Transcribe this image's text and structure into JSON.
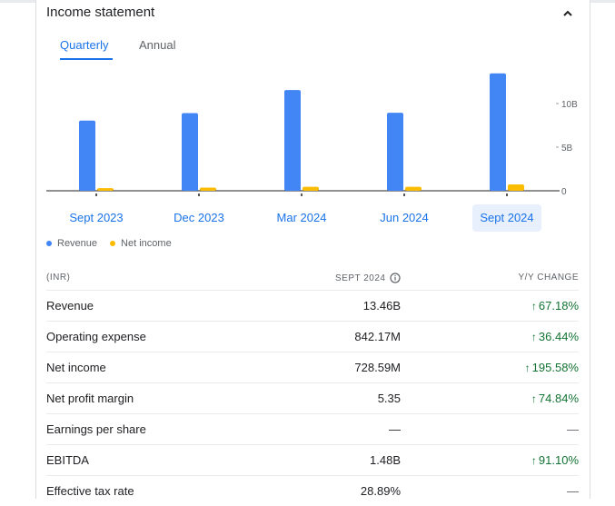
{
  "header": {
    "title": "Income statement"
  },
  "tabs": [
    {
      "label": "Quarterly",
      "active": true
    },
    {
      "label": "Annual",
      "active": false
    }
  ],
  "chart_data": {
    "type": "bar",
    "categories": [
      "Sept 2023",
      "Dec 2023",
      "Mar 2024",
      "Jun 2024",
      "Sept 2024"
    ],
    "series": [
      {
        "name": "Revenue",
        "color": "#4285f4",
        "values": [
          8.05,
          8.9,
          11.55,
          8.95,
          13.46
        ]
      },
      {
        "name": "Net income",
        "color": "#fbbc04",
        "values": [
          0.3,
          0.37,
          0.45,
          0.45,
          0.73
        ]
      }
    ],
    "yticks": [
      {
        "value": 0,
        "label": "0"
      },
      {
        "value": 5,
        "label": "5B"
      },
      {
        "value": 10,
        "label": "10B"
      }
    ],
    "ylim": [
      0,
      15
    ],
    "selected_category": "Sept 2024"
  },
  "legend": [
    {
      "label": "Revenue",
      "color": "#4285f4"
    },
    {
      "label": "Net income",
      "color": "#fbbc04"
    }
  ],
  "table": {
    "currency_header": "(INR)",
    "period_header": "SEPT 2024",
    "change_header": "Y/Y CHANGE",
    "rows": [
      {
        "label": "Revenue",
        "value": "13.46B",
        "change": "67.18%",
        "direction": "up"
      },
      {
        "label": "Operating expense",
        "value": "842.17M",
        "change": "36.44%",
        "direction": "up"
      },
      {
        "label": "Net income",
        "value": "728.59M",
        "change": "195.58%",
        "direction": "up"
      },
      {
        "label": "Net profit margin",
        "value": "5.35",
        "change": "74.84%",
        "direction": "up"
      },
      {
        "label": "Earnings per share",
        "value": "—",
        "change": "—",
        "direction": "none"
      },
      {
        "label": "EBITDA",
        "value": "1.48B",
        "change": "91.10%",
        "direction": "up"
      },
      {
        "label": "Effective tax rate",
        "value": "28.89%",
        "change": "—",
        "direction": "none"
      }
    ]
  }
}
